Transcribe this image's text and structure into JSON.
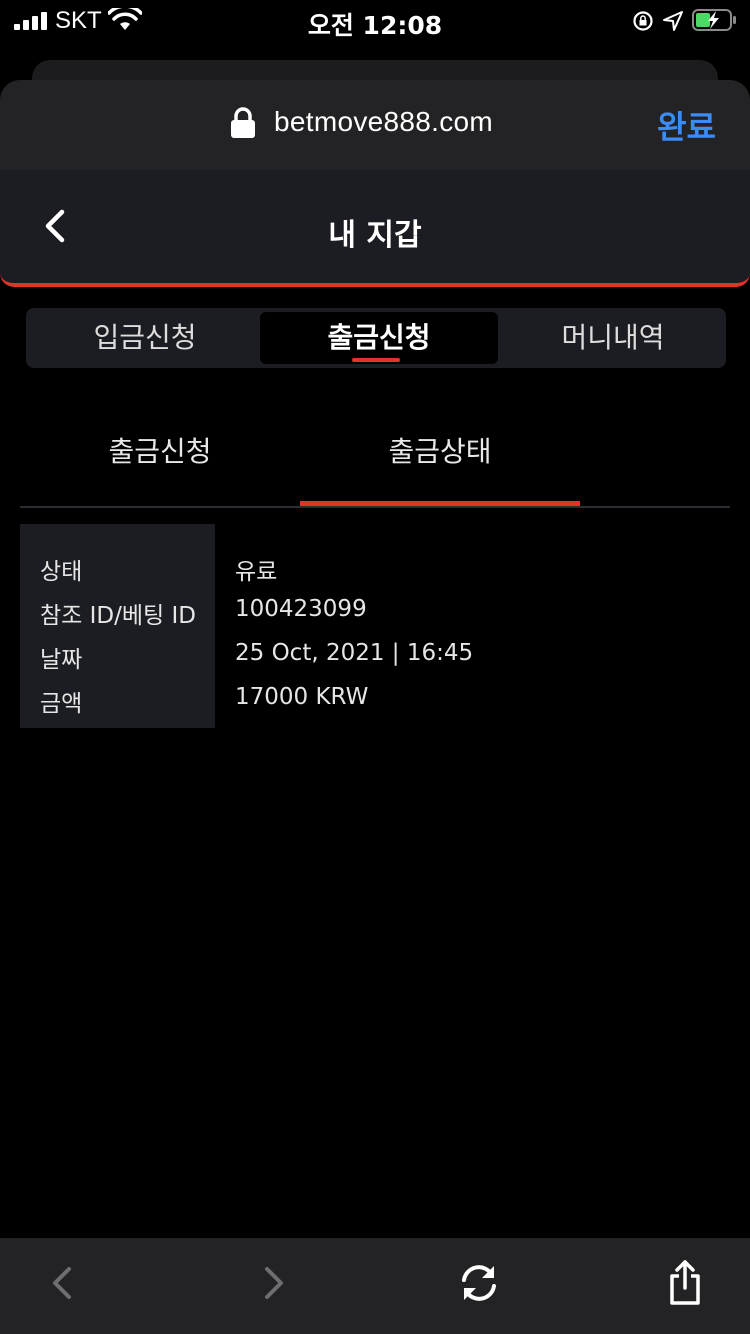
{
  "status_bar": {
    "carrier": "SKT",
    "time": "오전 12:08"
  },
  "browser": {
    "url": "betmove888.com",
    "done_label": "완료"
  },
  "header": {
    "title": "내 지갑"
  },
  "segmented_tabs": [
    {
      "label": "입금신청",
      "active": false
    },
    {
      "label": "출금신청",
      "active": true
    },
    {
      "label": "머니내역",
      "active": false
    }
  ],
  "sub_tabs": [
    {
      "label": "출금신청",
      "active": false
    },
    {
      "label": "출금상태",
      "active": true
    }
  ],
  "details": {
    "rows": [
      {
        "label": "상태",
        "value": "유료"
      },
      {
        "label": "참조 ID/베팅 ID",
        "value": "100423099"
      },
      {
        "label": "날짜",
        "value": "25 Oct, 2021 | 16:45"
      },
      {
        "label": "금액",
        "value": "17000 KRW"
      }
    ]
  },
  "colors": {
    "accent": "#e0342a",
    "link": "#3b8cf6"
  }
}
